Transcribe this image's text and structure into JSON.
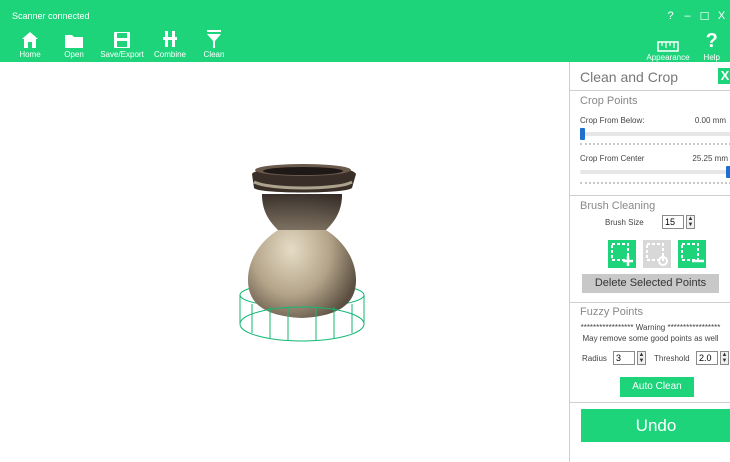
{
  "window": {
    "status": "Scanner connected",
    "controls": [
      "?",
      "–",
      "☐",
      "X"
    ]
  },
  "toolbar": {
    "home": "Home",
    "open": "Open",
    "save_export": "Save/Export",
    "combine": "Combine",
    "clean": "Clean",
    "appearance": "Appearance",
    "help": "Help"
  },
  "panel": {
    "title": "Clean and Crop",
    "close": "X",
    "crop_points": {
      "title": "Crop Points",
      "below_label": "Crop From Below:",
      "below_value": "0.00 mm",
      "below_level": 0.0,
      "center_label": "Crop From Center",
      "center_value": "25.25 mm",
      "center_level": 1.0
    },
    "brush": {
      "title": "Brush Cleaning",
      "size_label": "Brush Size",
      "size_value": "15",
      "delete_label": "Delete Selected Points"
    },
    "fuzzy": {
      "title": "Fuzzy Points",
      "warning": "***************** Warning *****************",
      "warning_sub": "May remove some good points as well",
      "radius_label": "Radius",
      "radius_value": "3",
      "threshold_label": "Threshold",
      "threshold_value": "2.0",
      "auto_clean": "Auto Clean"
    },
    "undo": "Undo"
  },
  "colors": {
    "accent": "#1ed47b",
    "slider_thumb": "#1f6fd1"
  }
}
